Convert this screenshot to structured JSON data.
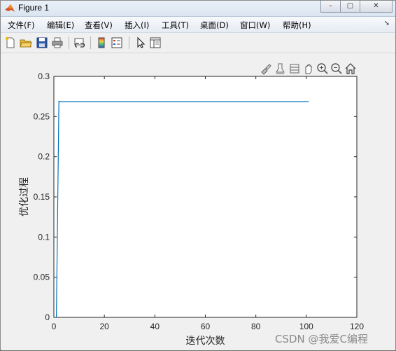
{
  "window": {
    "title": "Figure 1",
    "minimize_glyph": "–",
    "maximize_glyph": "▢",
    "close_glyph": "✕"
  },
  "menu": {
    "items": [
      {
        "label": "文件(F)"
      },
      {
        "label": "编辑(E)"
      },
      {
        "label": "查看(V)"
      },
      {
        "label": "插入(I)"
      },
      {
        "label": "工具(T)"
      },
      {
        "label": "桌面(D)"
      },
      {
        "label": "窗口(W)"
      },
      {
        "label": "帮助(H)"
      }
    ],
    "overflow_icon": "menu-overflow-arrow"
  },
  "toolbar": {
    "icons": [
      "new-figure-icon",
      "open-file-icon",
      "save-icon",
      "print-icon",
      "link-plot-icon",
      "colorbar-icon",
      "legend-icon",
      "pointer-icon",
      "property-inspector-icon"
    ]
  },
  "axes_toolbar": {
    "icons": [
      "brush-icon",
      "data-tips-icon",
      "rotate-icon",
      "pan-icon",
      "zoom-in-icon",
      "zoom-out-icon",
      "home-icon"
    ]
  },
  "colors": {
    "line": "#0072bd",
    "axes_bg": "#ffffff",
    "figure_bg": "#f0f0f0"
  },
  "chart_data": {
    "type": "line",
    "xlabel": "迭代次数",
    "ylabel": "优化过程",
    "xlim": [
      0,
      120
    ],
    "ylim": [
      0,
      0.3
    ],
    "xticks": [
      0,
      20,
      40,
      60,
      80,
      100,
      120
    ],
    "yticks": [
      0,
      0.05,
      0.1,
      0.15,
      0.2,
      0.25,
      0.3
    ],
    "xtick_labels": [
      "0",
      "20",
      "40",
      "60",
      "80",
      "100",
      "120"
    ],
    "ytick_labels": [
      "0",
      "0.05",
      "0.1",
      "0.15",
      "0.2",
      "0.25",
      "0.3"
    ],
    "grid": false,
    "series": [
      {
        "x": [
          1,
          2,
          2.5,
          101
        ],
        "y": [
          0,
          0.269,
          0.2685,
          0.2685
        ]
      }
    ]
  },
  "watermark": "CSDN @我爱C编程"
}
